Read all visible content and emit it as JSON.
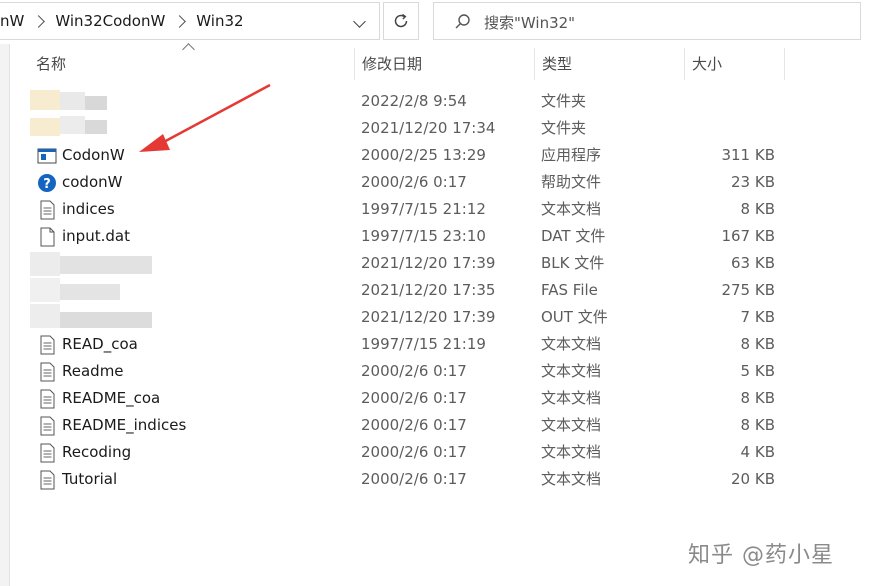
{
  "address_bar": {
    "crumbs": [
      "nW",
      "Win32CodonW",
      "Win32"
    ]
  },
  "search": {
    "placeholder": "搜索\"Win32\""
  },
  "columns": {
    "name": "名称",
    "date": "修改日期",
    "type": "类型",
    "size": "大小"
  },
  "files": [
    {
      "name": "",
      "date": "2022/2/8 9:54",
      "type": "文件夹",
      "size": "",
      "icon": "blurred-folder-icon"
    },
    {
      "name": "",
      "date": "2021/12/20 17:34",
      "type": "文件夹",
      "size": "",
      "icon": "blurred-folder-icon"
    },
    {
      "name": "CodonW",
      "date": "2000/2/25 13:29",
      "type": "应用程序",
      "size": "311 KB",
      "icon": "application-icon"
    },
    {
      "name": "codonW",
      "date": "2000/2/6 0:17",
      "type": "帮助文件",
      "size": "23 KB",
      "icon": "help-icon"
    },
    {
      "name": "indices",
      "date": "1997/7/15 21:12",
      "type": "文本文档",
      "size": "8 KB",
      "icon": "text-document-icon"
    },
    {
      "name": "input.dat",
      "date": "1997/7/15 23:10",
      "type": "DAT 文件",
      "size": "167 KB",
      "icon": "blank-file-icon"
    },
    {
      "name": "",
      "date": "2021/12/20 17:39",
      "type": "BLK 文件",
      "size": "63 KB",
      "icon": "blurred-file-icon"
    },
    {
      "name": "",
      "date": "2021/12/20 17:35",
      "type": "FAS File",
      "size": "275 KB",
      "icon": "blurred-file-icon"
    },
    {
      "name": "",
      "date": "2021/12/20 17:39",
      "type": "OUT 文件",
      "size": "7 KB",
      "icon": "blurred-file-icon"
    },
    {
      "name": "READ_coa",
      "date": "1997/7/15 21:19",
      "type": "文本文档",
      "size": "8 KB",
      "icon": "text-document-icon"
    },
    {
      "name": "Readme",
      "date": "2000/2/6 0:17",
      "type": "文本文档",
      "size": "5 KB",
      "icon": "text-document-icon"
    },
    {
      "name": "README_coa",
      "date": "2000/2/6 0:17",
      "type": "文本文档",
      "size": "8 KB",
      "icon": "text-document-icon"
    },
    {
      "name": "README_indices",
      "date": "2000/2/6 0:17",
      "type": "文本文档",
      "size": "8 KB",
      "icon": "text-document-icon"
    },
    {
      "name": "Recoding",
      "date": "2000/2/6 0:17",
      "type": "文本文档",
      "size": "4 KB",
      "icon": "text-document-icon"
    },
    {
      "name": "Tutorial",
      "date": "2000/2/6 0:17",
      "type": "文本文档",
      "size": "20 KB",
      "icon": "text-document-icon"
    }
  ],
  "watermark": "知乎 @药小星",
  "colors": {
    "arrow": "#e53935",
    "help_icon": "#1565c0",
    "app_icon": "#1565c0"
  }
}
